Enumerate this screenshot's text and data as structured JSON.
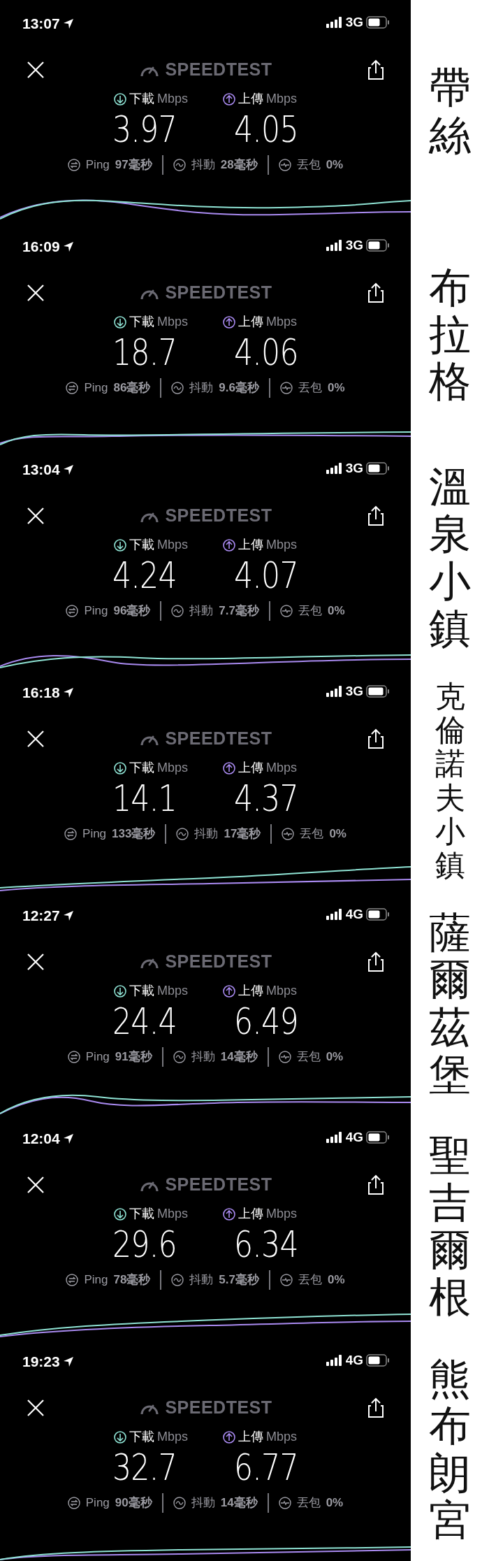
{
  "panels": [
    {
      "time": "13:07",
      "network": "3G",
      "logo": "SPEEDTEST",
      "download_label": "下載",
      "download_unit": "Mbps",
      "upload_label": "上傳",
      "upload_unit": "Mbps",
      "download": "3.97",
      "upload": "4.05",
      "ping_label": "Ping",
      "ping": "97毫秒",
      "jitter_label": "抖動",
      "jitter": "28毫秒",
      "loss_label": "丟包",
      "loss": "0%",
      "caption": "帶絲"
    },
    {
      "time": "16:09",
      "network": "3G",
      "logo": "SPEEDTEST",
      "download_label": "下載",
      "download_unit": "Mbps",
      "upload_label": "上傳",
      "upload_unit": "Mbps",
      "download": "18.7",
      "upload": "4.06",
      "ping_label": "Ping",
      "ping": "86毫秒",
      "jitter_label": "抖動",
      "jitter": "9.6毫秒",
      "loss_label": "丟包",
      "loss": "0%",
      "caption": "布拉格"
    },
    {
      "time": "13:04",
      "network": "3G",
      "logo": "SPEEDTEST",
      "download_label": "下載",
      "download_unit": "Mbps",
      "upload_label": "上傳",
      "upload_unit": "Mbps",
      "download": "4.24",
      "upload": "4.07",
      "ping_label": "Ping",
      "ping": "96毫秒",
      "jitter_label": "抖動",
      "jitter": "7.7毫秒",
      "loss_label": "丟包",
      "loss": "0%",
      "caption": "溫泉小鎮"
    },
    {
      "time": "16:18",
      "network": "3G",
      "logo": "SPEEDTEST",
      "download_label": "下載",
      "download_unit": "Mbps",
      "upload_label": "上傳",
      "upload_unit": "Mbps",
      "download": "14.1",
      "upload": "4.37",
      "ping_label": "Ping",
      "ping": "133毫秒",
      "jitter_label": "抖動",
      "jitter": "17毫秒",
      "loss_label": "丟包",
      "loss": "0%",
      "caption": "克倫諾夫小鎮"
    },
    {
      "time": "12:27",
      "network": "4G",
      "logo": "SPEEDTEST",
      "download_label": "下載",
      "download_unit": "Mbps",
      "upload_label": "上傳",
      "upload_unit": "Mbps",
      "download": "24.4",
      "upload": "6.49",
      "ping_label": "Ping",
      "ping": "91毫秒",
      "jitter_label": "抖動",
      "jitter": "14毫秒",
      "loss_label": "丟包",
      "loss": "0%",
      "caption": "薩爾茲堡"
    },
    {
      "time": "12:04",
      "network": "4G",
      "logo": "SPEEDTEST",
      "download_label": "下載",
      "download_unit": "Mbps",
      "upload_label": "上傳",
      "upload_unit": "Mbps",
      "download": "29.6",
      "upload": "6.34",
      "ping_label": "Ping",
      "ping": "78毫秒",
      "jitter_label": "抖動",
      "jitter": "5.7毫秒",
      "loss_label": "丟包",
      "loss": "0%",
      "caption": "聖吉爾根"
    },
    {
      "time": "19:23",
      "network": "4G",
      "logo": "SPEEDTEST",
      "download_label": "下載",
      "download_unit": "Mbps",
      "upload_label": "上傳",
      "upload_unit": "Mbps",
      "download": "32.7",
      "upload": "6.77",
      "ping_label": "Ping",
      "ping": "90毫秒",
      "jitter_label": "抖動",
      "jitter": "14毫秒",
      "loss_label": "丟包",
      "loss": "0%",
      "caption": "熊布朗宮"
    }
  ]
}
